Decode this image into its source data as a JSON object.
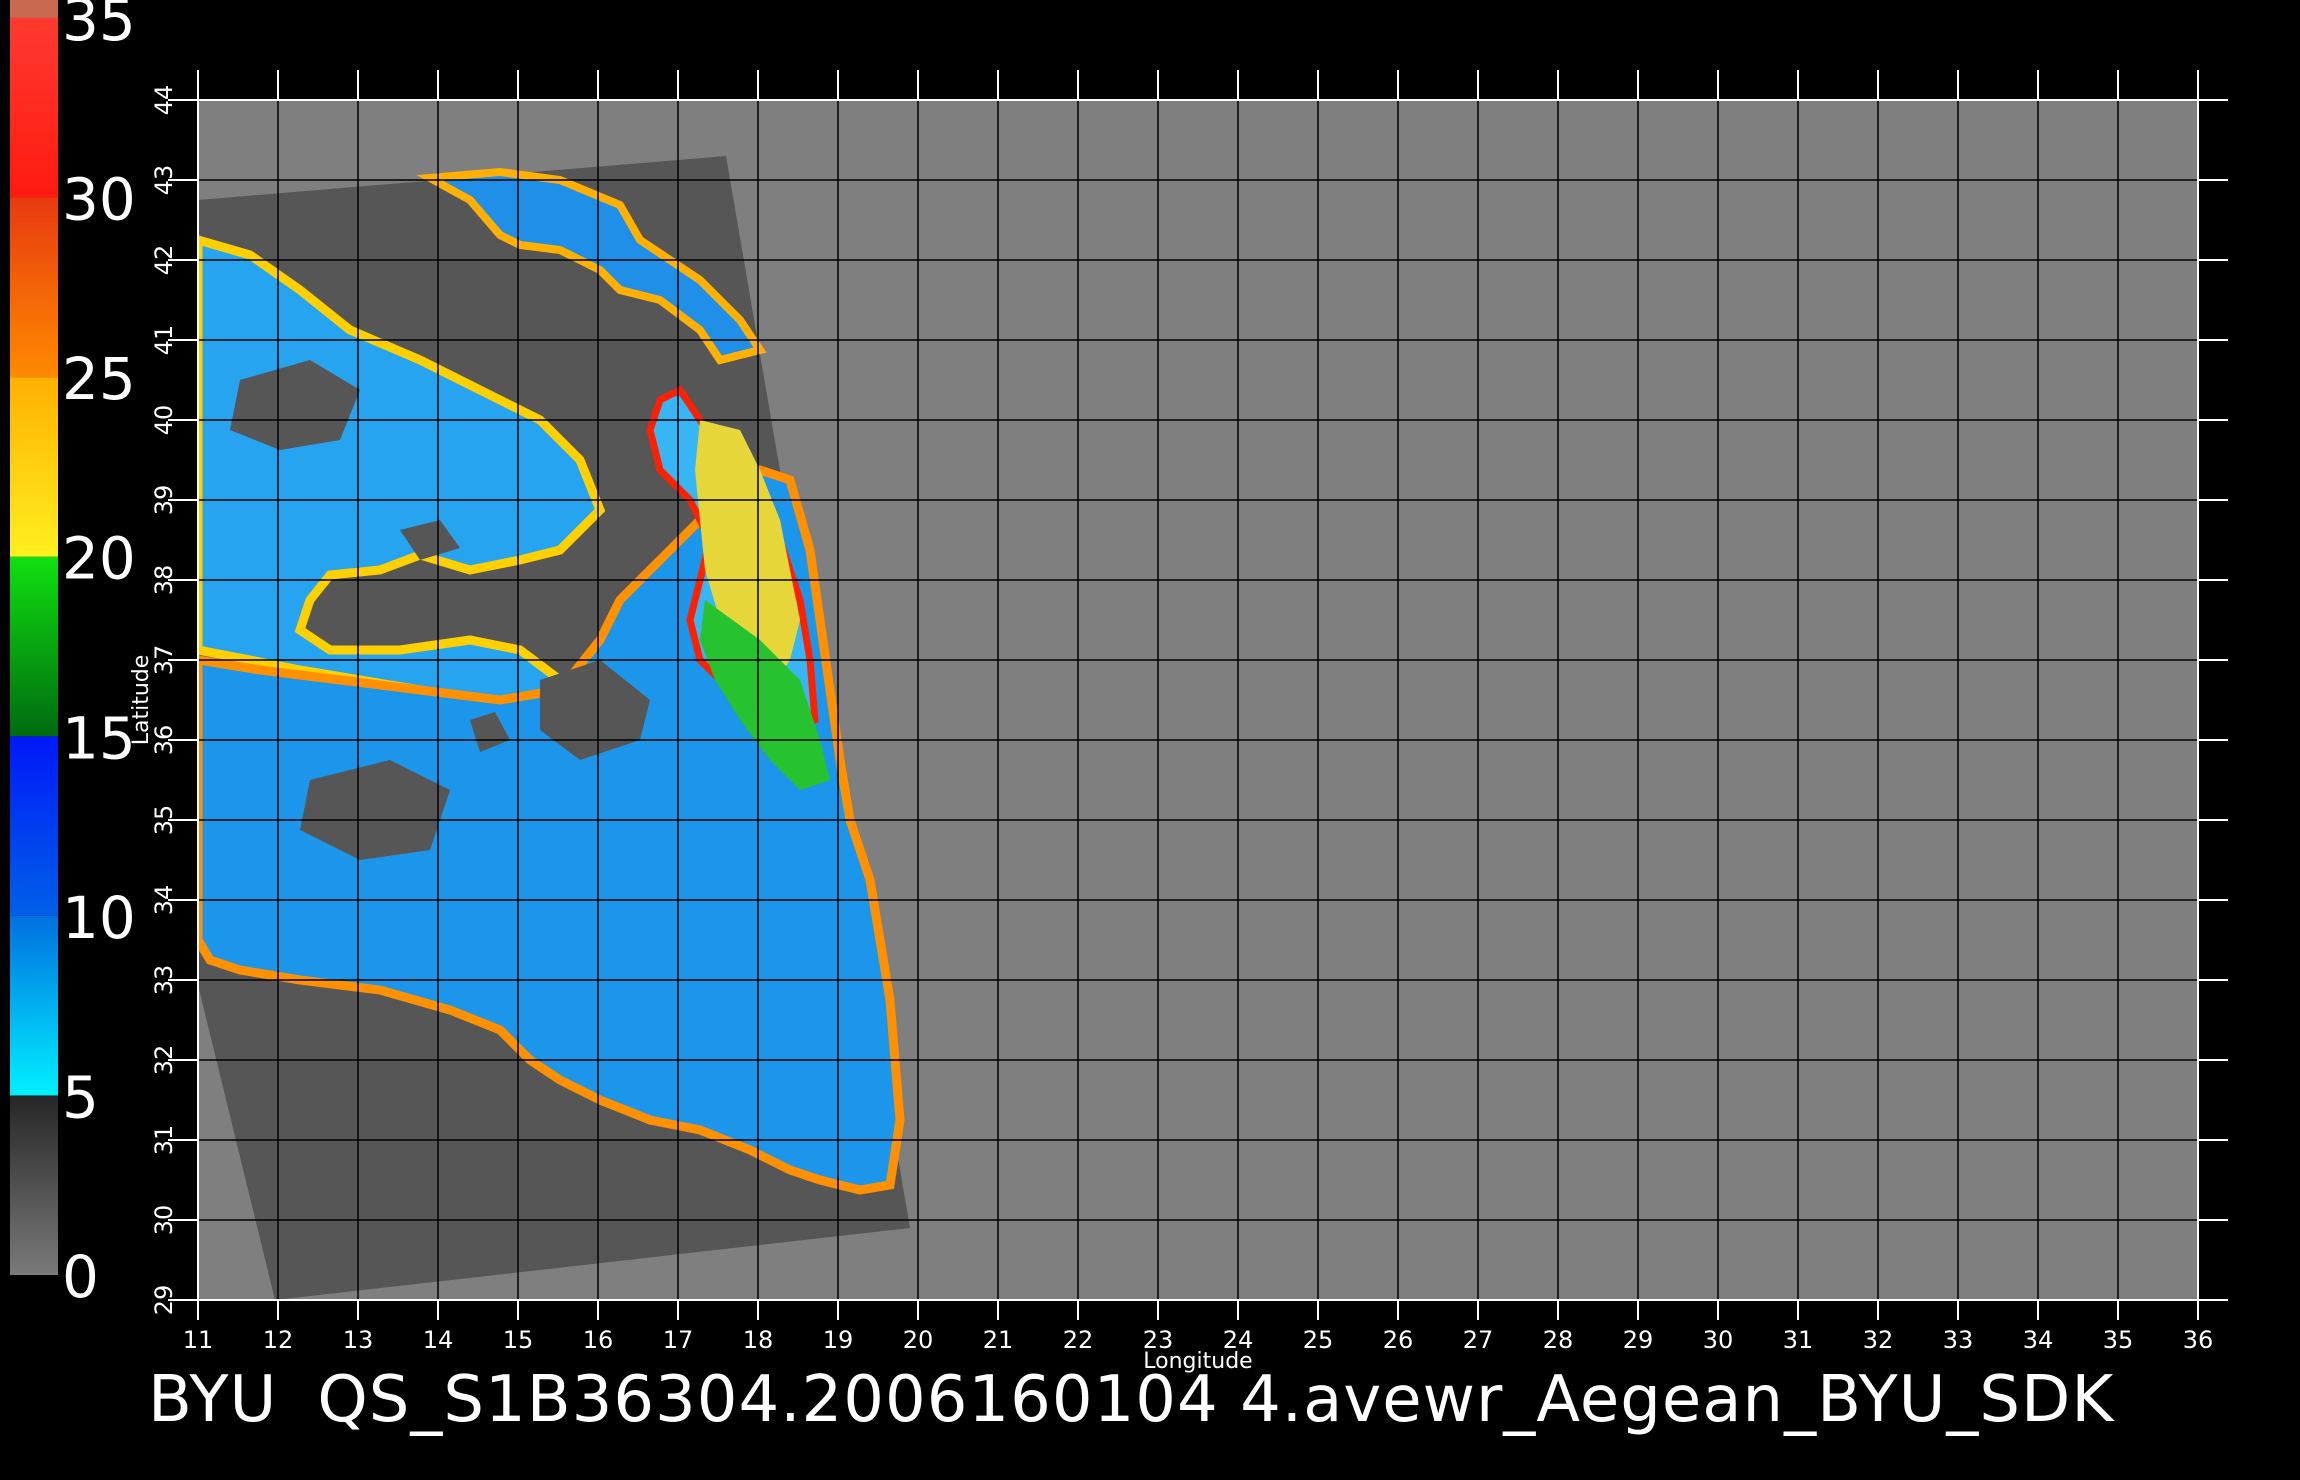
{
  "colorbar": {
    "labels": [
      "0",
      "5",
      "10",
      "15",
      "20",
      "25",
      "30",
      "35"
    ],
    "segments": [
      {
        "from": 0,
        "to": 5,
        "colors": [
          "#7a7a7a",
          "#262626"
        ]
      },
      {
        "from": 5,
        "to": 10,
        "colors": [
          "#00f0ff",
          "#0070e0"
        ]
      },
      {
        "from": 10,
        "to": 15,
        "colors": [
          "#0060e8",
          "#0018f8"
        ]
      },
      {
        "from": 15,
        "to": 20,
        "colors": [
          "#006a10",
          "#10e010"
        ]
      },
      {
        "from": 20,
        "to": 25,
        "colors": [
          "#fff020",
          "#ffb000"
        ]
      },
      {
        "from": 25,
        "to": 30,
        "colors": [
          "#ff8a00",
          "#e83a10"
        ]
      },
      {
        "from": 30,
        "to": 35,
        "colors": [
          "#ff1a10",
          "#ff3a30"
        ]
      },
      {
        "from": 35,
        "to": 36,
        "colors": [
          "#c86a50",
          "#c86a50"
        ]
      }
    ]
  },
  "axes": {
    "xlabel": "Longitude",
    "ylabel": "Latitude",
    "xlim": [
      11,
      36
    ],
    "ylim": [
      29,
      44
    ],
    "xticks": [
      11,
      12,
      13,
      14,
      15,
      16,
      17,
      18,
      19,
      20,
      21,
      22,
      23,
      24,
      25,
      26,
      27,
      28,
      29,
      30,
      31,
      32,
      33,
      34,
      35,
      36
    ],
    "yticks": [
      29,
      30,
      31,
      32,
      33,
      34,
      35,
      36,
      37,
      38,
      39,
      40,
      41,
      42,
      43,
      44
    ]
  },
  "caption": {
    "source": "BYU",
    "filename": "QS_S1B36304.2006160104 4.avewr_Aegean_BYU_SDK"
  },
  "colors": {
    "background": "#000000",
    "no_data": "#7f7f7f",
    "swath_land": "#555555",
    "grid": "#000000"
  }
}
